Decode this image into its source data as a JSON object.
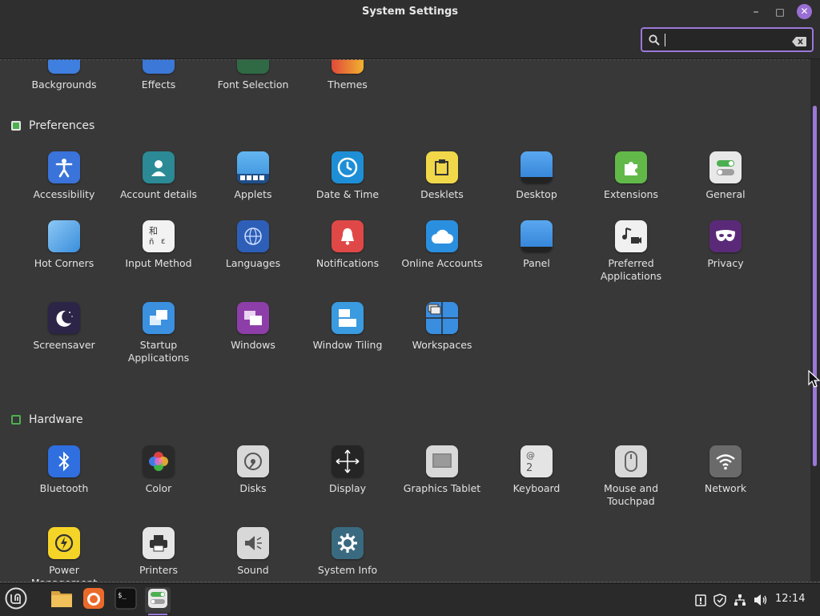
{
  "window": {
    "title": "System Settings",
    "minimize_icon": "–",
    "maximize_icon": "□",
    "close_icon": "✕"
  },
  "search": {
    "value": "",
    "placeholder": ""
  },
  "appearance_items": [
    {
      "label": "Backgrounds",
      "icon": "backgrounds-icon",
      "color": "#3f7fe0"
    },
    {
      "label": "Effects",
      "icon": "effects-icon",
      "color": "#3b78d8"
    },
    {
      "label": "Font Selection",
      "icon": "font-selection-icon",
      "color": "#2f6a45"
    },
    {
      "label": "Themes",
      "icon": "themes-icon",
      "color": "#e0493a"
    }
  ],
  "preferences": {
    "title": "Preferences",
    "items": [
      {
        "label": "Accessibility",
        "icon": "accessibility-icon",
        "color": "#3a73d9"
      },
      {
        "label": "Account details",
        "icon": "account-details-icon",
        "color": "#2b8a95"
      },
      {
        "label": "Applets",
        "icon": "applets-icon",
        "color": "#4aa3e8"
      },
      {
        "label": "Date & Time",
        "icon": "clock-icon",
        "color": "#1e8fd6"
      },
      {
        "label": "Desklets",
        "icon": "desklets-icon",
        "color": "#f0d84a"
      },
      {
        "label": "Desktop",
        "icon": "desktop-icon",
        "color": "#3d8fe0"
      },
      {
        "label": "Extensions",
        "icon": "extensions-icon",
        "color": "#62b94a"
      },
      {
        "label": "General",
        "icon": "general-icon",
        "color": "#e8e8e8"
      },
      {
        "label": "Hot Corners",
        "icon": "hot-corners-icon",
        "color": "#4da2ea"
      },
      {
        "label": "Input Method",
        "icon": "input-method-icon",
        "color": "#f2f2f2"
      },
      {
        "label": "Languages",
        "icon": "languages-icon",
        "color": "#2e5fb8"
      },
      {
        "label": "Notifications",
        "icon": "notifications-icon",
        "color": "#e04848"
      },
      {
        "label": "Online Accounts",
        "icon": "online-accounts-icon",
        "color": "#2b8fe0"
      },
      {
        "label": "Panel",
        "icon": "panel-icon",
        "color": "#3d8fe0"
      },
      {
        "label": "Preferred Applications",
        "icon": "preferred-applications-icon",
        "color": "#f0f0f0"
      },
      {
        "label": "Privacy",
        "icon": "privacy-icon",
        "color": "#5a2a78"
      },
      {
        "label": "Screensaver",
        "icon": "screensaver-icon",
        "color": "#2c2547"
      },
      {
        "label": "Startup Applications",
        "icon": "startup-applications-icon",
        "color": "#3b90e0"
      },
      {
        "label": "Windows",
        "icon": "windows-icon",
        "color": "#8d3ea8"
      },
      {
        "label": "Window Tiling",
        "icon": "window-tiling-icon",
        "color": "#3a9be0"
      },
      {
        "label": "Workspaces",
        "icon": "workspaces-icon",
        "color": "#3a8ee0"
      }
    ]
  },
  "hardware": {
    "title": "Hardware",
    "items": [
      {
        "label": "Bluetooth",
        "icon": "bluetooth-icon",
        "color": "#2f6fe0"
      },
      {
        "label": "Color",
        "icon": "color-icon",
        "color": "#2a2a2a"
      },
      {
        "label": "Disks",
        "icon": "disks-icon",
        "color": "#d8d8d8"
      },
      {
        "label": "Display",
        "icon": "display-icon",
        "color": "#252525"
      },
      {
        "label": "Graphics Tablet",
        "icon": "graphics-tablet-icon",
        "color": "#d8d8d8"
      },
      {
        "label": "Keyboard",
        "icon": "keyboard-icon",
        "color": "#e4e4e4"
      },
      {
        "label": "Mouse and Touchpad",
        "icon": "mouse-icon",
        "color": "#d8d8d8"
      },
      {
        "label": "Network",
        "icon": "network-icon",
        "color": "#6a6a6a"
      },
      {
        "label": "Power Management",
        "icon": "power-icon",
        "color": "#f5d428"
      },
      {
        "label": "Printers",
        "icon": "printer-icon",
        "color": "#e6e6e6"
      },
      {
        "label": "Sound",
        "icon": "sound-icon",
        "color": "#d8d8d8"
      },
      {
        "label": "System Info",
        "icon": "gear-icon",
        "color": "#3a6a80"
      }
    ]
  },
  "taskbar": {
    "clock": "12:14",
    "items": [
      "menu-icon",
      "files-icon",
      "firefox-icon",
      "terminal-icon",
      "system-settings-icon"
    ],
    "tray": [
      "notice-icon",
      "shield-icon",
      "network-tray-icon",
      "volume-icon"
    ]
  },
  "colors": {
    "accent": "#9b78d8",
    "background": "#383838",
    "titlebar": "#2f2f2f"
  }
}
